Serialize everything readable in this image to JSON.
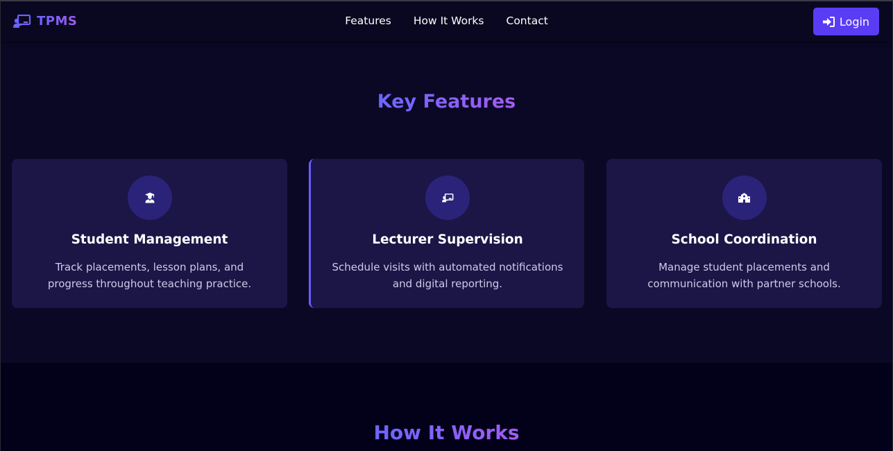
{
  "navbar": {
    "brand": "TPMS",
    "links": [
      {
        "label": "Features"
      },
      {
        "label": "How It Works"
      },
      {
        "label": "Contact"
      }
    ],
    "login_label": "Login"
  },
  "features": {
    "title": "Key Features",
    "cards": [
      {
        "icon": "student-graduate-icon",
        "title": "Student Management",
        "description": "Track placements, lesson plans, and progress throughout teaching practice."
      },
      {
        "icon": "chalkboard-teacher-icon",
        "title": "Lecturer Supervision",
        "description": "Schedule visits with automated notifications and digital reporting."
      },
      {
        "icon": "school-icon",
        "title": "School Coordination",
        "description": "Manage student placements and communication with partner schools."
      }
    ]
  },
  "how_it_works": {
    "title": "How It Works"
  },
  "colors": {
    "accent": "#5b3cf5",
    "gradient_start": "#6b63ff",
    "gradient_end": "#a25cf0",
    "card_bg": "#1b1646",
    "icon_circle": "#2b237a",
    "section_bg": "#0b0826",
    "page_bg": "#03011a"
  }
}
